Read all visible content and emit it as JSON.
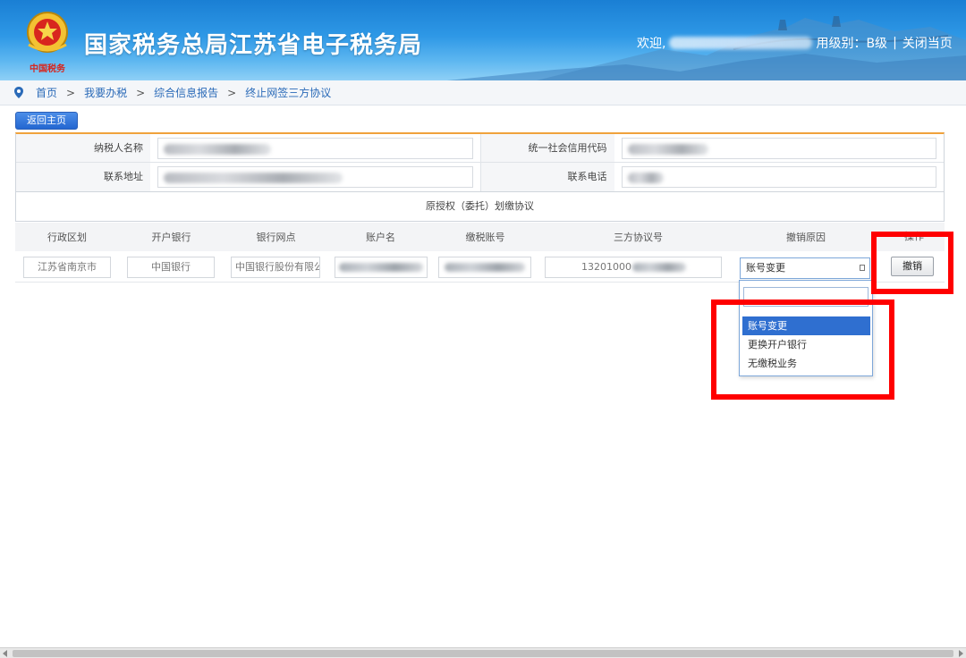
{
  "header": {
    "site_title": "国家税务总局江苏省电子税务局",
    "welcome_prefix": "欢迎,",
    "credit_level": "用级别：B级",
    "separator": "|",
    "close_link": "关闭当页",
    "emblem_text": "中国税务"
  },
  "breadcrumb": {
    "items": [
      "首页",
      "我要办税",
      "综合信息报告",
      "终止网签三方协议"
    ],
    "separator": ">"
  },
  "back_button": "返回主页",
  "taxpayer_info": {
    "name_label": "纳税人名称",
    "credit_code_label": "统一社会信用代码",
    "address_label": "联系地址",
    "phone_label": "联系电话"
  },
  "agreement_title": "原授权（委托）划缴协议",
  "grid": {
    "columns": [
      "行政区划",
      "开户银行",
      "银行网点",
      "账户名",
      "缴税账号",
      "三方协议号",
      "撤销原因",
      "操作"
    ],
    "row": {
      "region": "江苏省南京市",
      "bank": "中国银行",
      "branch": "中国银行股份有限公",
      "agreement_no": "13201000",
      "reason_selected": "账号变更",
      "action": "撤销"
    }
  },
  "reason_dropdown": {
    "options": [
      "账号变更",
      "更换开户银行",
      "无缴税业务"
    ],
    "selected_index": 0
  },
  "colors": {
    "header_blue": "#1a7fd4",
    "link_blue": "#2a6ab8",
    "highlight_red": "#ff0000",
    "selected_option": "#2f6fd0",
    "table_accent": "#f0a23c"
  }
}
